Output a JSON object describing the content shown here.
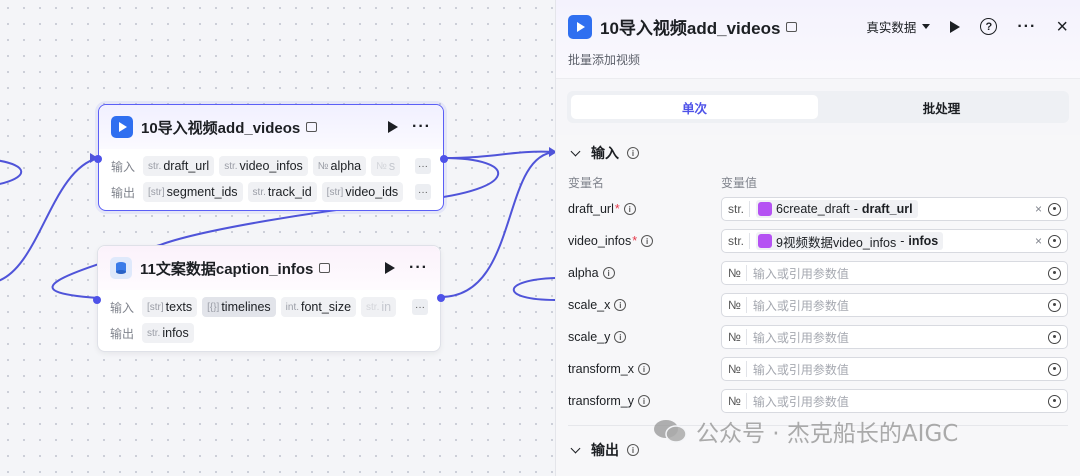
{
  "node_video": {
    "title": "10导入视频add_videos",
    "input_label": "输入",
    "output_label": "输出",
    "inputs": [
      {
        "type": "str.",
        "name": "draft_url"
      },
      {
        "type": "str.",
        "name": "video_infos"
      },
      {
        "type": "№",
        "name": "alpha"
      },
      {
        "type": "№",
        "name": "s"
      }
    ],
    "outputs": [
      {
        "type": "[str]",
        "name": "segment_ids"
      },
      {
        "type": "str.",
        "name": "track_id"
      },
      {
        "type": "[str]",
        "name": "video_ids"
      }
    ]
  },
  "node_caption": {
    "title": "11文案数据caption_infos",
    "input_label": "输入",
    "output_label": "输出",
    "inputs": [
      {
        "type": "[str]",
        "name": "texts"
      },
      {
        "type": "[{}]",
        "name": "timelines"
      },
      {
        "type": "int.",
        "name": "font_size"
      },
      {
        "type": "str.",
        "name": "in"
      }
    ],
    "outputs": [
      {
        "type": "str.",
        "name": "infos"
      }
    ]
  },
  "panel": {
    "title": "10导入视频add_videos",
    "subtitle": "批量添加视频",
    "data_mode": "真实数据",
    "tabs": [
      "单次",
      "批处理"
    ],
    "active_tab": 0,
    "input_section": "输入",
    "col_name": "变量名",
    "col_value": "变量值",
    "placeholder": "输入或引用参数值",
    "params": [
      {
        "name": "draft_url",
        "required": true,
        "type": "str.",
        "ref_node": "6create_draft",
        "ref_sep": " - ",
        "ref_field": "draft_url"
      },
      {
        "name": "video_infos",
        "required": true,
        "type": "str.",
        "ref_node": "9视频数据video_infos",
        "ref_sep": " - ",
        "ref_field": "infos"
      },
      {
        "name": "alpha",
        "required": false,
        "type": "№"
      },
      {
        "name": "scale_x",
        "required": false,
        "type": "№"
      },
      {
        "name": "scale_y",
        "required": false,
        "type": "№"
      },
      {
        "name": "transform_x",
        "required": false,
        "type": "№"
      },
      {
        "name": "transform_y",
        "required": false,
        "type": "№"
      }
    ],
    "output_section": "输出"
  },
  "watermark": "公众号 · 杰克船长的AIGC",
  "colors": {
    "accent": "#4e52e8",
    "edge": "#4f54d9",
    "panel_bg": "#f7f7f9"
  }
}
